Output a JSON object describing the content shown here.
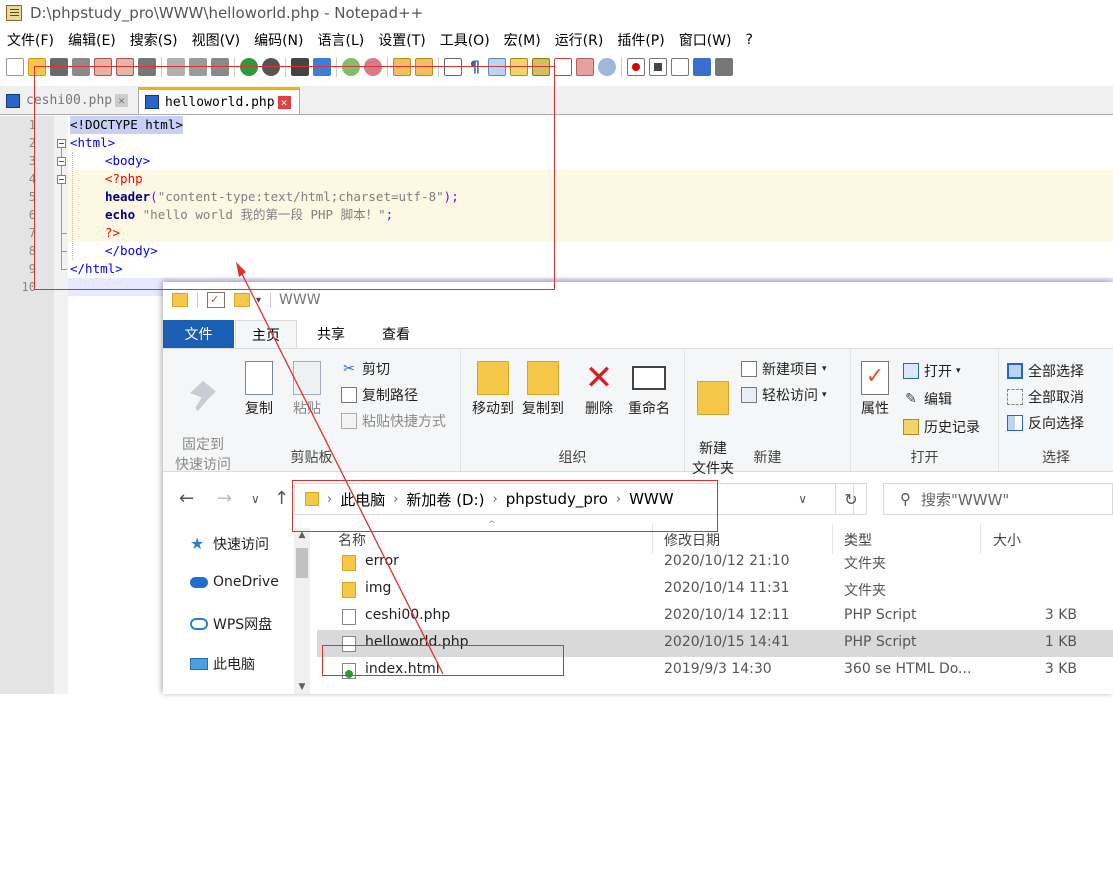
{
  "npp": {
    "title": "D:\\phpstudy_pro\\WWW\\helloworld.php - Notepad++",
    "menu": [
      "文件(F)",
      "编辑(E)",
      "搜索(S)",
      "视图(V)",
      "编码(N)",
      "语言(L)",
      "设置(T)",
      "工具(O)",
      "宏(M)",
      "运行(R)",
      "插件(P)",
      "窗口(W)",
      "?"
    ],
    "tabs": [
      {
        "label": "ceshi00.php",
        "active": false
      },
      {
        "label": "helloworld.php",
        "active": true
      }
    ],
    "line_numbers": [
      "1",
      "2",
      "3",
      "4",
      "5",
      "6",
      "7",
      "8",
      "9",
      "10"
    ],
    "code": {
      "l1": "<!DOCTYPE html>",
      "l2": "<html>",
      "l3": "<body>",
      "l4": "<?php",
      "l5_fn": "header",
      "l5_p1": "(",
      "l5_str": "\"content-type:text/html;charset=utf-8\"",
      "l5_p2": ");",
      "l6_fn": "echo",
      "l6_str": "\"hello world 我的第一段 PHP 脚本！\"",
      "l6_p": ";",
      "l7": "?>",
      "l8": "</body>",
      "l9": "</html>"
    }
  },
  "explorer": {
    "title": "WWW",
    "ribbon_tabs": [
      "文件",
      "主页",
      "共享",
      "查看"
    ],
    "clipboard": {
      "label": "剪贴板",
      "pin": "固定到\n快速访问",
      "copy": "复制",
      "paste": "粘贴",
      "cut": "剪切",
      "copy_path": "复制路径",
      "paste_shortcut": "粘贴快捷方式"
    },
    "organize": {
      "label": "组织",
      "move_to": "移动到",
      "copy_to": "复制到",
      "delete": "删除",
      "rename": "重命名"
    },
    "new": {
      "label": "新建",
      "new_folder": "新建\n文件夹",
      "new_item": "新建项目",
      "easy_access": "轻松访问"
    },
    "open": {
      "label": "打开",
      "properties": "属性",
      "open": "打开",
      "edit": "编辑",
      "history": "历史记录"
    },
    "select": {
      "label": "选择",
      "select_all": "全部选择",
      "select_none": "全部取消",
      "invert": "反向选择"
    },
    "breadcrumb": [
      "此电脑",
      "新加卷 (D:)",
      "phpstudy_pro",
      "WWW"
    ],
    "search_placeholder": "搜索\"WWW\"",
    "nav": [
      "快速访问",
      "OneDrive",
      "WPS网盘",
      "此电脑"
    ],
    "columns": [
      "名称",
      "修改日期",
      "类型",
      "大小"
    ],
    "files": [
      {
        "name": "error",
        "date": "2020/10/12 21:10",
        "type": "文件夹",
        "size": "",
        "icon": "folder-icon"
      },
      {
        "name": "img",
        "date": "2020/10/14 11:31",
        "type": "文件夹",
        "size": "",
        "icon": "folder-icon"
      },
      {
        "name": "ceshi00.php",
        "date": "2020/10/14 12:11",
        "type": "PHP Script",
        "size": "3 KB",
        "icon": "php-file-icon"
      },
      {
        "name": "helloworld.php",
        "date": "2020/10/15 14:41",
        "type": "PHP Script",
        "size": "1 KB",
        "icon": "php-file-icon",
        "selected": true
      },
      {
        "name": "index.html",
        "date": "2019/9/3 14:30",
        "type": "360 se HTML Do...",
        "size": "3 KB",
        "icon": "html-file-icon"
      }
    ]
  },
  "colors": {
    "annotation": "#e03030",
    "ribbon_file_tab": "#1a5fb4",
    "npp_active_tab_accent": "#f4b400"
  }
}
